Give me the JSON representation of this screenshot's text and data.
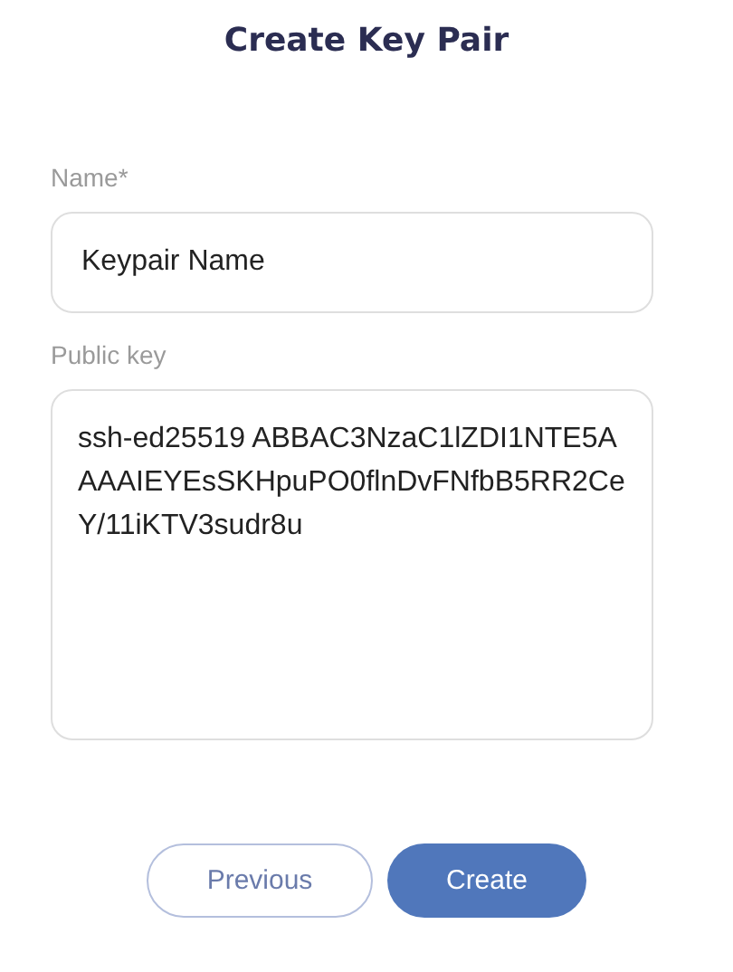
{
  "title": "Create Key Pair",
  "fields": [
    {
      "kind": "input",
      "label": "Name*",
      "value": "Keypair Name"
    },
    {
      "kind": "textarea",
      "label": "Public key",
      "value": "ssh-ed25519 ABBAC3NzaC1lZDI1NTE5AAAAIEYEsSKHpuPO0flnDvFNfbB5RR2CeY/11iKTV3sudr8u"
    }
  ],
  "buttons": [
    {
      "kind": "secondary",
      "label": "Previous"
    },
    {
      "kind": "primary",
      "label": "Create"
    }
  ]
}
